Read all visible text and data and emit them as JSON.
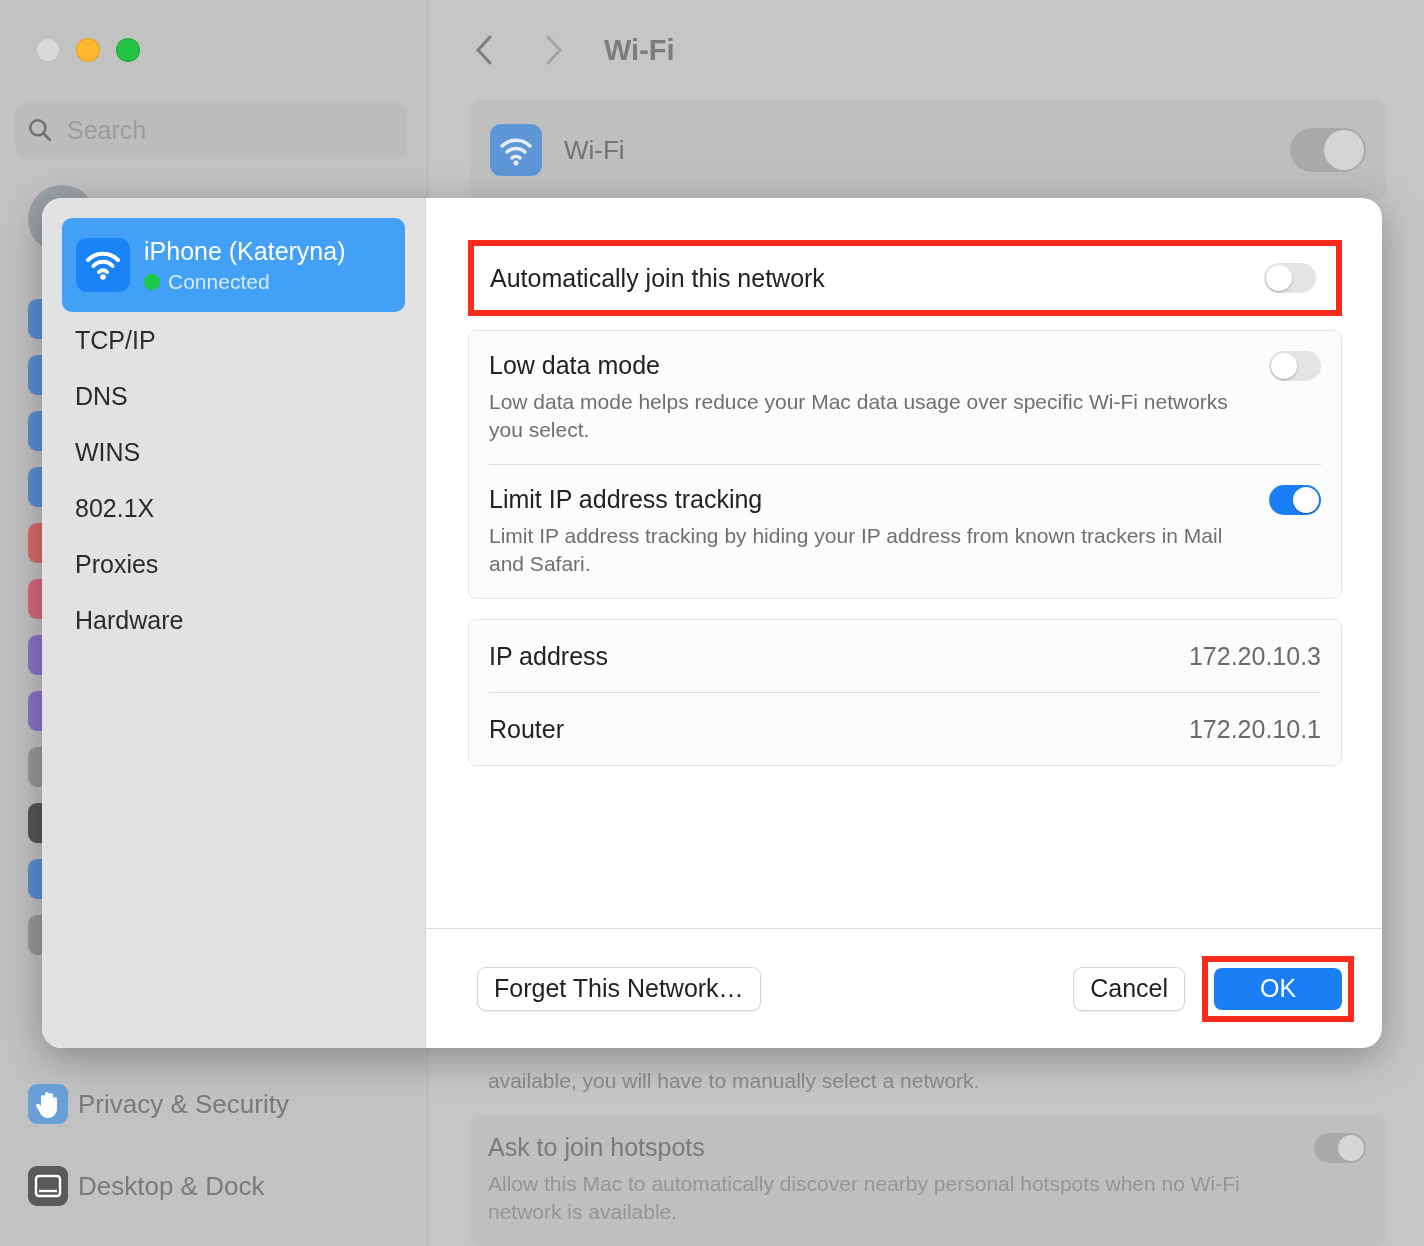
{
  "window": {
    "controls": [
      {
        "color": "#d9dbdb"
      },
      {
        "color": "#fdb82e"
      },
      {
        "color": "#22c343"
      }
    ]
  },
  "sidebar": {
    "search": {
      "placeholder": "Search"
    },
    "items": [
      {
        "label": "Privacy & Security",
        "kind": "hand"
      },
      {
        "label": "Desktop & Dock",
        "kind": "dock"
      }
    ]
  },
  "header": {
    "title": "Wi-Fi"
  },
  "wifi_card": {
    "label": "Wi-Fi",
    "on": true
  },
  "background_note": "available, you will have to manually select a network.",
  "hotspots": {
    "title": "Ask to join hotspots",
    "description": "Allow this Mac to automatically discover nearby personal hotspots when no Wi-Fi network is available.",
    "on": true
  },
  "dialog": {
    "network": {
      "name": "iPhone (Kateryna)",
      "status": "Connected",
      "selected": true
    },
    "tabs": [
      {
        "label": "TCP/IP",
        "selected": false
      },
      {
        "label": "DNS",
        "selected": false
      },
      {
        "label": "WINS",
        "selected": false
      },
      {
        "label": "802.1X",
        "selected": false
      },
      {
        "label": "Proxies",
        "selected": false
      },
      {
        "label": "Hardware",
        "selected": false
      }
    ],
    "auto_join": {
      "label": "Automatically join this network",
      "on": false,
      "highlighted": true
    },
    "options": [
      {
        "title": "Low data mode",
        "description": "Low data mode helps reduce your Mac data usage over specific Wi-Fi networks you select.",
        "on": false
      },
      {
        "title": "Limit IP address tracking",
        "description": "Limit IP address tracking by hiding your IP address from known trackers in Mail and Safari.",
        "on": true
      }
    ],
    "info": [
      {
        "label": "IP address",
        "value": "172.20.10.3"
      },
      {
        "label": "Router",
        "value": "172.20.10.1"
      }
    ],
    "buttons": [
      {
        "label": "Forget This Network…",
        "kind": "secondary",
        "highlighted": false
      },
      {
        "label": "Cancel",
        "kind": "secondary",
        "highlighted": false
      },
      {
        "label": "OK",
        "kind": "primary",
        "highlighted": true
      }
    ]
  }
}
